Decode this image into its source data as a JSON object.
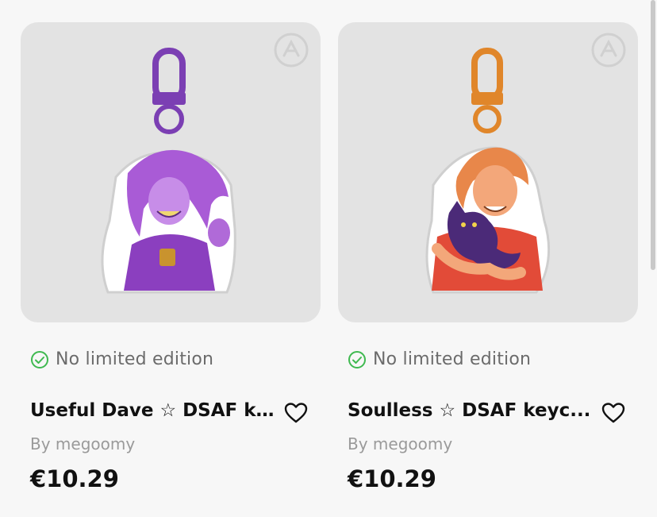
{
  "products": [
    {
      "edition_label": "No limited edition",
      "title": "Useful Dave ☆ DSAF k...",
      "author": "By megoomy",
      "price": "€10.29",
      "accent": "#8a4fc0"
    },
    {
      "edition_label": "No limited edition",
      "title": "Soulless ☆ DSAF keyc...",
      "author": "By megoomy",
      "price": "€10.29",
      "accent": "#e08a2a"
    }
  ],
  "colors": {
    "check": "#3fb950",
    "card_bg": "#e3e3e3",
    "page_bg": "#f7f7f7"
  }
}
